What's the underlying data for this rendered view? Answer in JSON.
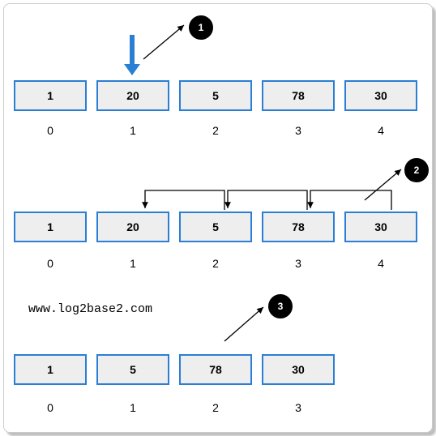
{
  "step1": {
    "values": [
      "1",
      "20",
      "5",
      "78",
      "30"
    ],
    "indices": [
      "0",
      "1",
      "2",
      "3",
      "4"
    ],
    "badge": "1"
  },
  "step2": {
    "values": [
      "1",
      "20",
      "5",
      "78",
      "30"
    ],
    "indices": [
      "0",
      "1",
      "2",
      "3",
      "4"
    ],
    "badge": "2"
  },
  "step3": {
    "values": [
      "1",
      "5",
      "78",
      "30"
    ],
    "indices": [
      "0",
      "1",
      "2",
      "3"
    ],
    "badge": "3"
  },
  "watermark": "www.log2base2.com",
  "colors": {
    "cell_border": "#2a7fd4",
    "cell_fill": "#eeeeee",
    "downarrow": "#2a7fd4",
    "badge": "#000000"
  }
}
